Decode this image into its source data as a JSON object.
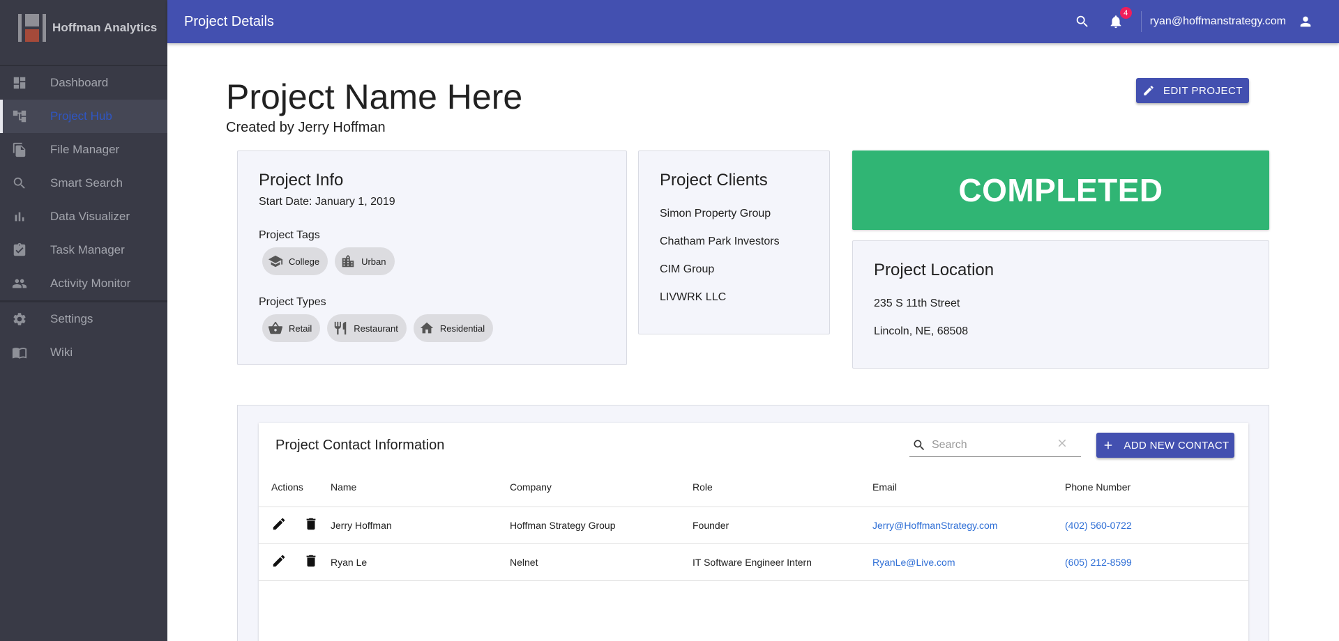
{
  "app": {
    "brand": "Hoffman Analytics"
  },
  "sidebar": {
    "items": [
      {
        "label": "Dashboard",
        "icon": "dashboard-icon"
      },
      {
        "label": "Project Hub",
        "icon": "hub-icon",
        "active": true
      },
      {
        "label": "File Manager",
        "icon": "file-icon"
      },
      {
        "label": "Smart Search",
        "icon": "search-icon"
      },
      {
        "label": "Data Visualizer",
        "icon": "bar-chart-icon"
      },
      {
        "label": "Task Manager",
        "icon": "task-icon"
      },
      {
        "label": "Activity Monitor",
        "icon": "people-icon"
      }
    ],
    "secondary": [
      {
        "label": "Settings",
        "icon": "gear-icon"
      },
      {
        "label": "Wiki",
        "icon": "book-icon"
      }
    ]
  },
  "topbar": {
    "title": "Project Details",
    "notifications": "4",
    "email": "ryan@hoffmanstrategy.com"
  },
  "project": {
    "name": "Project Name Here",
    "created_by": "Created by Jerry Hoffman",
    "edit_label": "EDIT PROJECT",
    "status": "COMPLETED"
  },
  "info": {
    "title": "Project Info",
    "start_date": "Start Date: January 1, 2019",
    "tags_label": "Project Tags",
    "tags": [
      {
        "label": "College",
        "icon": "school-icon"
      },
      {
        "label": "Urban",
        "icon": "building-icon"
      }
    ],
    "types_label": "Project Types",
    "types": [
      {
        "label": "Retail",
        "icon": "basket-icon"
      },
      {
        "label": "Restaurant",
        "icon": "utensils-icon"
      },
      {
        "label": "Residential",
        "icon": "home-icon"
      }
    ]
  },
  "clients": {
    "title": "Project Clients",
    "items": [
      "Simon Property Group",
      "Chatham Park Investors",
      "CIM Group",
      "LIVWRK LLC"
    ]
  },
  "location": {
    "title": "Project Location",
    "line1": "235 S 11th Street",
    "line2": "Lincoln, NE, 68508"
  },
  "contacts": {
    "title": "Project Contact Information",
    "search_placeholder": "Search",
    "add_label": "ADD NEW CONTACT",
    "columns": [
      "Actions",
      "Name",
      "Company",
      "Role",
      "Email",
      "Phone Number"
    ],
    "rows": [
      {
        "name": "Jerry Hoffman",
        "company": "Hoffman Strategy Group",
        "role": "Founder",
        "email": "Jerry@HoffmanStrategy.com",
        "phone": "(402) 560-0722"
      },
      {
        "name": "Ryan Le",
        "company": "Nelnet",
        "role": "IT Software Engineer Intern",
        "email": "RyanLe@Live.com",
        "phone": "(605) 212-8599"
      }
    ]
  },
  "colors": {
    "primary": "#4350b0",
    "status": "#30b574",
    "sidebar": "#393a46",
    "link": "#2f6fd6"
  }
}
